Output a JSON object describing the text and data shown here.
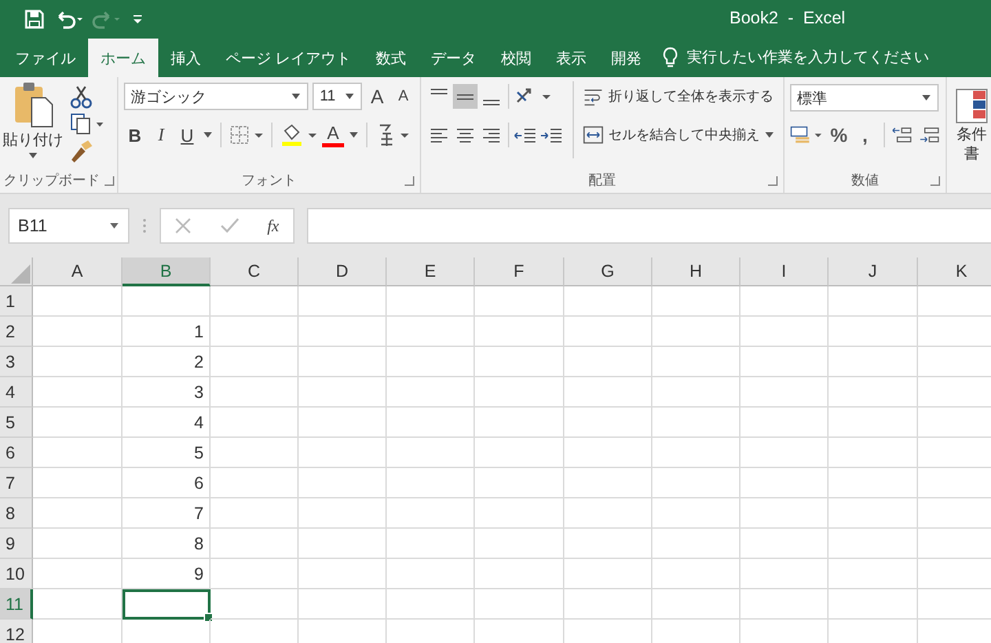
{
  "window": {
    "title": "Book2  -  Excel"
  },
  "tabs": [
    {
      "label": "ファイル",
      "selected": false
    },
    {
      "label": "ホーム",
      "selected": true
    },
    {
      "label": "挿入",
      "selected": false
    },
    {
      "label": "ページ レイアウト",
      "selected": false
    },
    {
      "label": "数式",
      "selected": false
    },
    {
      "label": "データ",
      "selected": false
    },
    {
      "label": "校閲",
      "selected": false
    },
    {
      "label": "表示",
      "selected": false
    },
    {
      "label": "開発",
      "selected": false
    }
  ],
  "tell_me": {
    "placeholder": "実行したい作業を入力してください"
  },
  "ribbon": {
    "clipboard": {
      "label": "クリップボード",
      "paste": "貼り付け"
    },
    "font": {
      "label": "フォント",
      "font_name": "游ゴシック",
      "font_size": "11",
      "grow": "A",
      "shrink": "A",
      "bold": "B",
      "italic": "I",
      "underline": "U",
      "font_color": "A"
    },
    "alignment": {
      "label": "配置",
      "wrap": "折り返して全体を表示する",
      "merge": "セルを結合して中央揃え"
    },
    "number": {
      "label": "数値",
      "format": "標準",
      "percent": "%",
      "comma": ","
    },
    "styles": {
      "conditional": "条件",
      "format": "書"
    }
  },
  "formula_bar": {
    "name_box": "B11",
    "fx": "fx"
  },
  "sheet": {
    "columns": [
      {
        "label": "A",
        "selected": false
      },
      {
        "label": "B",
        "selected": true
      },
      {
        "label": "C",
        "selected": false
      },
      {
        "label": "D",
        "selected": false
      },
      {
        "label": "E",
        "selected": false
      },
      {
        "label": "F",
        "selected": false
      },
      {
        "label": "G",
        "selected": false
      },
      {
        "label": "H",
        "selected": false
      },
      {
        "label": "I",
        "selected": false
      },
      {
        "label": "J",
        "selected": false
      },
      {
        "label": "K",
        "selected": false
      }
    ],
    "rows": [
      {
        "label": "1",
        "selected": false
      },
      {
        "label": "2",
        "selected": false,
        "column_b": "1"
      },
      {
        "label": "3",
        "selected": false,
        "column_b": "2"
      },
      {
        "label": "4",
        "selected": false,
        "column_b": "3"
      },
      {
        "label": "5",
        "selected": false,
        "column_b": "4"
      },
      {
        "label": "6",
        "selected": false,
        "column_b": "5"
      },
      {
        "label": "7",
        "selected": false,
        "column_b": "6"
      },
      {
        "label": "8",
        "selected": false,
        "column_b": "7"
      },
      {
        "label": "9",
        "selected": false,
        "column_b": "8"
      },
      {
        "label": "10",
        "selected": false,
        "column_b": "9"
      },
      {
        "label": "11",
        "selected": true
      },
      {
        "label": "12",
        "selected": false
      }
    ]
  }
}
